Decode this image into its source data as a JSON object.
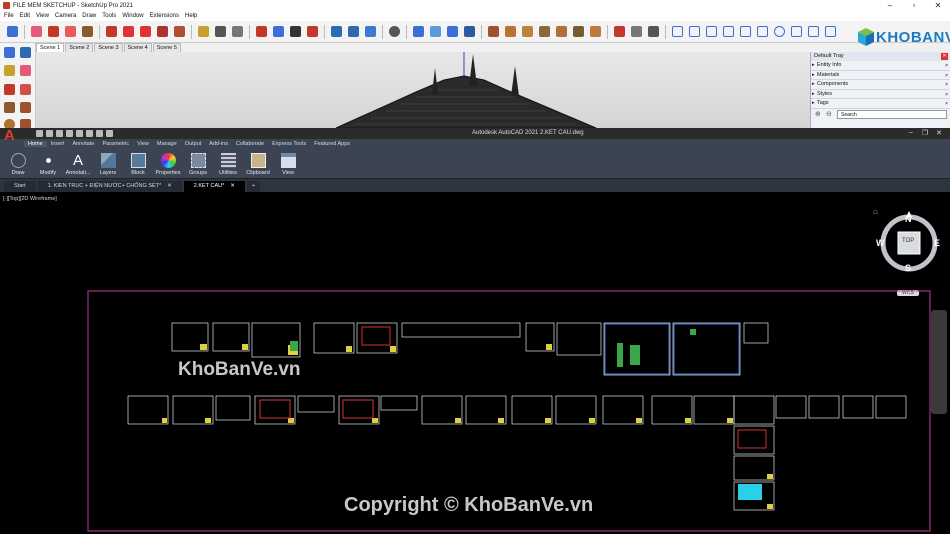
{
  "sketchup": {
    "title": "FILE MEM SKETCHUP - SketchUp Pro 2021",
    "menu": [
      "File",
      "Edit",
      "View",
      "Camera",
      "Draw",
      "Tools",
      "Window",
      "Extensions",
      "Help"
    ],
    "scenes": [
      "Scene 1",
      "Scene 2",
      "Scene 3",
      "Scene 4",
      "Scene 5"
    ],
    "tray": {
      "title": "Default Tray",
      "panels": [
        "Entity Info",
        "Materials",
        "Components",
        "Styles",
        "Tags"
      ],
      "search_placeholder": "Search"
    },
    "logo_text": "KHOBANVE"
  },
  "autocad": {
    "title": "Autodesk AutoCAD 2021     2.KET CAU.dwg",
    "logo": "A",
    "tabs": [
      "Home",
      "Insert",
      "Annotate",
      "Parametric",
      "View",
      "Manage",
      "Output",
      "Add-ins",
      "Collaborate",
      "Express Tools",
      "Featured Apps"
    ],
    "ribbon": [
      {
        "label": "Draw",
        "icon": "draw-icon"
      },
      {
        "label": "Modify",
        "icon": "modify-icon"
      },
      {
        "label": "Annotati...",
        "icon": "annotation-icon"
      },
      {
        "label": "Layers",
        "icon": "layers-icon"
      },
      {
        "label": "Block",
        "icon": "block-icon"
      },
      {
        "label": "Properties",
        "icon": "properties-icon"
      },
      {
        "label": "Groups",
        "icon": "groups-icon"
      },
      {
        "label": "Utilities",
        "icon": "utilities-icon"
      },
      {
        "label": "Clipboard",
        "icon": "clipboard-icon"
      },
      {
        "label": "View",
        "icon": "view-icon"
      }
    ],
    "doc_tabs": [
      "Start",
      "1. KIEN TRUC + ĐIỆN NƯỚC+ CHỐNG SÉT*",
      "2.KET CAU*"
    ],
    "view_label": "[-][Top][2D Wireframe]",
    "viewcube": {
      "n": "N",
      "s": "S",
      "e": "E",
      "w": "W",
      "top": "TOP"
    },
    "wcs": "WCS",
    "watermark_center": "KhoBanVe.vn",
    "watermark_bottom": "Copyright © KhoBanVe.vn"
  }
}
